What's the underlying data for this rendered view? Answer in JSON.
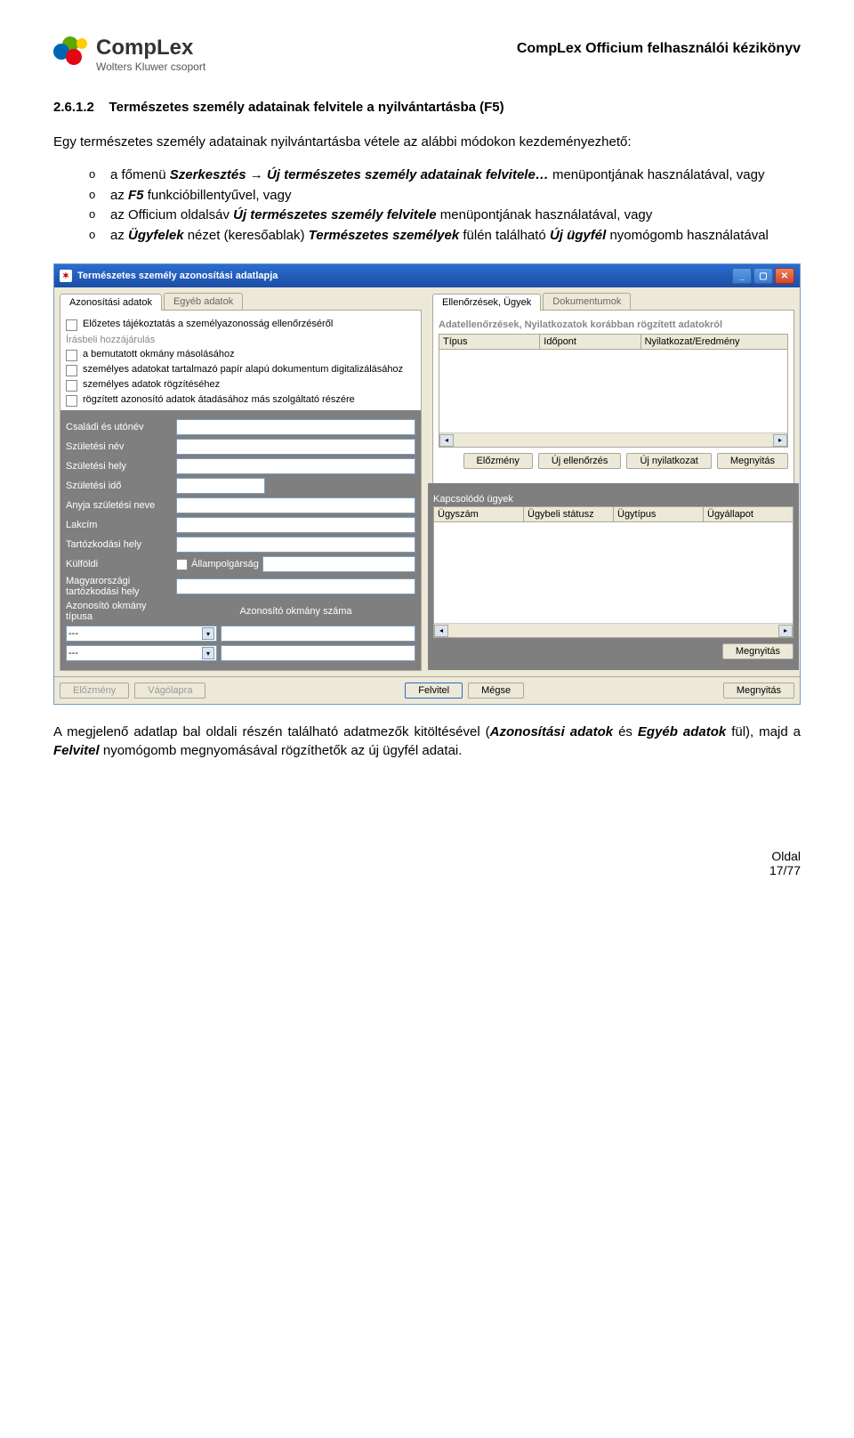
{
  "header": {
    "logo_name": "CompLex",
    "logo_sub": "Wolters Kluwer csoport",
    "doc_title": "CompLex Officium felhasználói kézikönyv"
  },
  "section": {
    "number": "2.6.1.2",
    "title": "Természetes személy adatainak felvitele a nyilvántartásba (F5)"
  },
  "intro": "Egy természetes személy adatainak nyilvántartásba vétele az alábbi módokon kezdeményezhető:",
  "bullets": {
    "b1_pre": "a főmenü ",
    "b1_bi1": "Szerkesztés",
    "b1_arrow": " → ",
    "b1_bi2": "Új természetes személy adatainak felvitele…",
    "b1_post": " menüpontjának használatával, vagy",
    "b2_pre": "az ",
    "b2_bi": "F5",
    "b2_post": " funkcióbillentyűvel, vagy",
    "b3_pre": "az Officium oldalsáv ",
    "b3_bi": "Új természetes személy felvitele",
    "b3_post": " menüpontjának használatával, vagy",
    "b4_pre": "az ",
    "b4_bi1": "Ügyfelek",
    "b4_mid1": " nézet (keresőablak) ",
    "b4_bi2": "Természetes személyek",
    "b4_mid2": " fülén található ",
    "b4_bi3": "Új ügyfél",
    "b4_post": " nyomógomb használatával"
  },
  "app": {
    "title": "Természetes személy azonosítási adatlapja",
    "tabs_left": {
      "t1": "Azonosítási adatok",
      "t2": "Egyéb adatok"
    },
    "tabs_right": {
      "t1": "Ellenőrzések, Ügyek",
      "t2": "Dokumentumok"
    },
    "left": {
      "chk_header": "Előzetes tájékoztatás a személyazonosság ellenőrzéséről",
      "group": "Írásbeli hozzájárulás",
      "chk1": "a bemutatott okmány másolásához",
      "chk2": "személyes adatokat tartalmazó papír alapú dokumentum digitalizálásához",
      "chk3": "személyes adatok rögzítéséhez",
      "chk4": "rögzített azonosító adatok átadásához más szolgáltató részére",
      "f_csaladi": "Családi és utónév",
      "f_szulnev": "Születési név",
      "f_szulhely": "Születési hely",
      "f_szulido": "Születési idő",
      "f_anyja": "Anyja születési neve",
      "f_lakcim": "Lakcím",
      "f_tart": "Tartózkodási hely",
      "f_kulfoldi": "Külföldi",
      "f_allam": "Állampolgárság",
      "f_magyar": "Magyarországi tartózkodási hely",
      "f_okmtyp": "Azonosító okmány típusa",
      "f_okmnum": "Azonosító okmány száma",
      "sel_placeholder": "---"
    },
    "right": {
      "subhead": "Adatellenőrzések, Nyilatkozatok korábban rögzített adatokról",
      "cols1": {
        "c1": "Típus",
        "c2": "Időpont",
        "c3": "Nyilatkozat/Eredmény"
      },
      "btns1": {
        "b1": "Előzmény",
        "b2": "Új ellenőrzés",
        "b3": "Új nyilatkozat",
        "b4": "Megnyitás"
      },
      "subhead2": "Kapcsolódó ügyek",
      "cols2": {
        "c1": "Ügyszám",
        "c2": "Ügybeli státusz",
        "c3": "Ügytípus",
        "c4": "Ügyállapot"
      },
      "btn_open": "Megnyitás"
    },
    "footer": {
      "elozmeny": "Előzmény",
      "vagolap": "Vágólapra",
      "felvitel": "Felvitel",
      "megse": "Mégse",
      "megnyitas": "Megnyitás"
    }
  },
  "closing": {
    "pre": "A megjelenő adatlap bal oldali részén található adatmezők kitöltésével (",
    "bi1": "Azonosítási adatok",
    "mid1": " és ",
    "bi2": "Egyéb adatok",
    "mid2": " fül), majd a ",
    "bi3": "Felvitel",
    "post": " nyomógomb megnyomásával rögzíthetők az új ügyfél adatai."
  },
  "pagefoot": {
    "label": "Oldal",
    "num": "17/77"
  }
}
